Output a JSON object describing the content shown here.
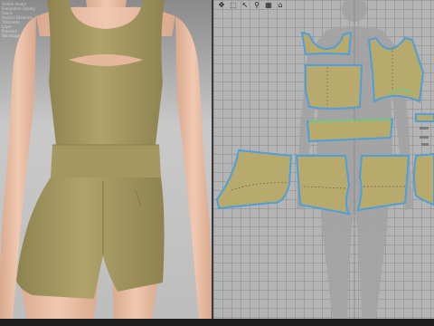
{
  "viewport_3d": {
    "overlay_lines": [
      "Visible Avatar",
      "Simulation Quality",
      "Fabric",
      "Particle Distance",
      "Thickness",
      "Layer",
      "Pressure",
      "Shrinkage"
    ]
  },
  "viewport_2d": {
    "toolbar": [
      {
        "icon": "transform-pattern-icon",
        "glyph": "✥"
      },
      {
        "icon": "pattern-outline-icon",
        "glyph": "⬚"
      },
      {
        "icon": "edit-point-icon",
        "glyph": "↖"
      },
      {
        "icon": "sewing-icon",
        "glyph": "⚲"
      },
      {
        "icon": "grid-icon",
        "glyph": "▦"
      },
      {
        "icon": "trace-icon",
        "glyph": "⌂"
      }
    ]
  },
  "colors": {
    "fabric": "#a99c62",
    "fabric_shade": "#8c804c",
    "pattern_fill": "#b8aa6c",
    "seam_blue": "#4f9fd8",
    "seam_green": "#7bc47f",
    "skin": "#e9c0a7"
  }
}
